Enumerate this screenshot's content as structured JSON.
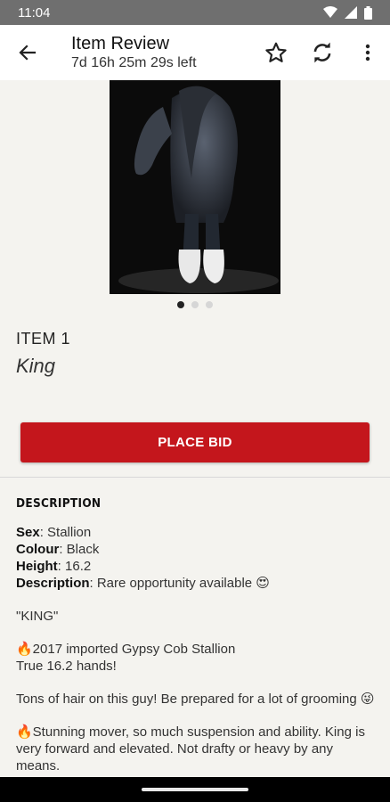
{
  "status": {
    "time": "11:04"
  },
  "appbar": {
    "title": "Item Review",
    "subtitle": "7d 16h 25m 29s left",
    "icons": {
      "back": "arrow-left-icon",
      "favorite": "star-outline-icon",
      "refresh": "refresh-icon",
      "more": "more-vert-icon"
    }
  },
  "gallery": {
    "image_subject": "black Gypsy Cob stallion on dark background",
    "page_count": 3,
    "active_page": 1
  },
  "item": {
    "number": "ITEM 1",
    "name": "King"
  },
  "bid": {
    "label": "PLACE BID",
    "color": "#c4161c"
  },
  "description": {
    "heading": "DESCRIPTION",
    "fields": [
      {
        "key": "Sex",
        "value": ": Stallion"
      },
      {
        "key": "Colour",
        "value": ": Black"
      },
      {
        "key": "Height",
        "value": ": 16.2"
      },
      {
        "key": "Description",
        "value": ": Rare opportunity available 😍"
      }
    ],
    "quote": "\"KING\"",
    "para1_line1": "🔥2017 imported Gypsy Cob Stallion",
    "para1_line2": "True 16.2 hands!",
    "para2": "Tons of hair on this guy! Be prepared for a lot of grooming 😜",
    "para3": "🔥Stunning mover, so much suspension and ability. King is very forward and elevated. Not drafty or heavy by any means."
  }
}
